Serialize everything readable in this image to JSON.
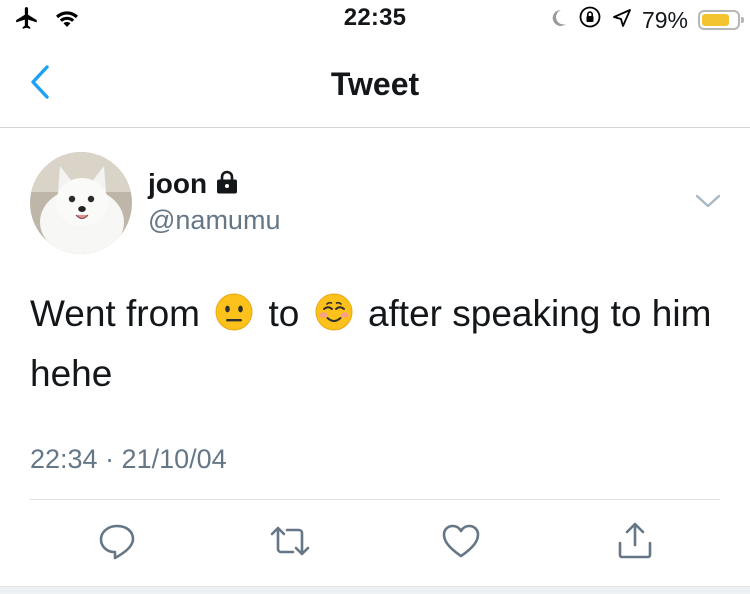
{
  "status_bar": {
    "time": "22:35",
    "battery_percent": "79%",
    "battery_level": 0.79,
    "icons": [
      "airplane-icon",
      "wifi-icon",
      "moon-icon",
      "orientation-lock-icon",
      "location-icon",
      "battery-icon"
    ]
  },
  "nav": {
    "title": "Tweet",
    "back_icon": "chevron-left-icon"
  },
  "tweet": {
    "author_name": "joon",
    "author_handle": "@namumu",
    "protected_icon": "lock-icon",
    "text_part1": "Went from ",
    "emoji1": "neutral-face",
    "text_part2": " to ",
    "emoji2": "smiling-face",
    "text_part3": " after speaking to him hehe",
    "timestamp": "22:34 · 21/10/04",
    "menu_icon": "chevron-down-icon"
  },
  "actions": [
    {
      "name": "reply",
      "icon": "reply-icon"
    },
    {
      "name": "retweet",
      "icon": "retweet-icon"
    },
    {
      "name": "like",
      "icon": "heart-icon"
    },
    {
      "name": "share",
      "icon": "share-icon"
    }
  ],
  "colors": {
    "accent": "#1da1f2",
    "secondary_text": "#657786",
    "icon_gray": "#657786",
    "battery_fill": "#f4c430"
  }
}
